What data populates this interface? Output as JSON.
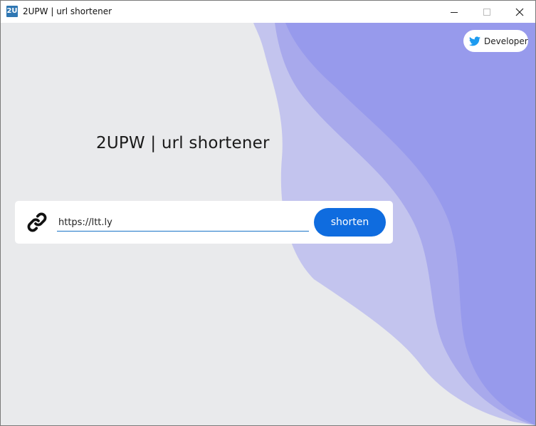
{
  "window": {
    "title": "2UPW | url shortener",
    "icon_text": "2U"
  },
  "developer_button": {
    "label": "Developer",
    "icon": "twitter-bird-icon",
    "color": "#1d9bf0"
  },
  "heading": "2UPW | url shortener",
  "shortener": {
    "input_value": "https://ltt.ly",
    "button_label": "shorten",
    "link_icon": "link-icon"
  },
  "colors": {
    "background": "#e9eaec",
    "wave_light": "#c3c4ee",
    "wave_mid": "#a8a9ec",
    "wave_dark": "#979aec",
    "button": "#0f6cdf"
  }
}
